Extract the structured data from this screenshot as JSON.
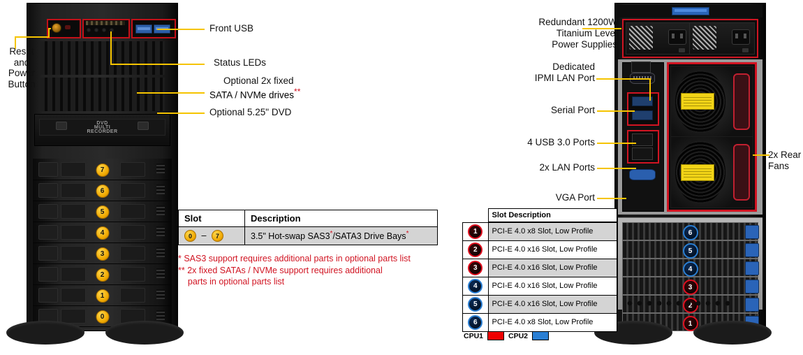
{
  "front": {
    "callouts": {
      "reset_power": "Reset\nand\nPower\nButton",
      "front_usb": "Front USB",
      "status_leds": "Status LEDs",
      "optional_sata_line1": "Optional 2x fixed",
      "optional_sata_line2": "SATA / NVMe drives",
      "optional_sata_mark": "**",
      "optional_dvd": "Optional 5.25\" DVD"
    },
    "drive_bays": [
      "7",
      "6",
      "5",
      "4",
      "3",
      "2",
      "1",
      "0"
    ]
  },
  "bay_table": {
    "headers": [
      "Slot",
      "Description"
    ],
    "row": {
      "slot_from": "0",
      "slot_dash": "–",
      "slot_to": "7",
      "description_pre": "3.5\" Hot-swap  SAS3",
      "description_mark1": "*",
      "description_mid": "/SATA3 Drive Bays",
      "description_mark2": "*"
    },
    "notes": [
      "* SAS3 support requires additional parts in optional parts list",
      "** 2x fixed SATAs / NVMe support requires additional",
      "    parts in optional parts list"
    ]
  },
  "rear": {
    "callouts": {
      "psu_line1": "Redundant 1200W",
      "psu_line2": "Titanium Level",
      "psu_line3": "Power Supplies",
      "ipmi_line1": "Dedicated",
      "ipmi_line2": "IPMI LAN Port",
      "serial": "Serial Port",
      "usb": "4 USB 3.0 Ports",
      "lan": "2x LAN Ports",
      "vga": "VGA Port",
      "fans_line1": "2x Rear",
      "fans_line2": "Fans"
    },
    "pci_numbers": [
      "6",
      "5",
      "4",
      "3",
      "2",
      "1"
    ]
  },
  "pci_table": {
    "header": "Slot Description",
    "rows": [
      {
        "num": "1",
        "cpu": "cpu1",
        "desc": "PCI-E 4.0 x8 Slot, Low Profile"
      },
      {
        "num": "2",
        "cpu": "cpu1",
        "desc": "PCI-E 4.0 x16 Slot, Low Profile"
      },
      {
        "num": "3",
        "cpu": "cpu1",
        "desc": "PCI-E 4.0 x16 Slot, Low Profile"
      },
      {
        "num": "4",
        "cpu": "cpu2",
        "desc": "PCI-E 4.0 x16 Slot, Low Profile"
      },
      {
        "num": "5",
        "cpu": "cpu2",
        "desc": "PCI-E 4.0 x16 Slot, Low Profile"
      },
      {
        "num": "6",
        "cpu": "cpu2",
        "desc": "PCI-E 4.0 x8 Slot, Low Profile"
      }
    ],
    "legend": {
      "cpu1_label": "CPU1",
      "cpu2_label": "CPU2"
    }
  },
  "colors": {
    "cpu1": "#ee0000",
    "cpu2": "#2a7fd4",
    "leader": "#f5c400",
    "highlight_box": "#d11422",
    "note_text": "#d11422"
  }
}
